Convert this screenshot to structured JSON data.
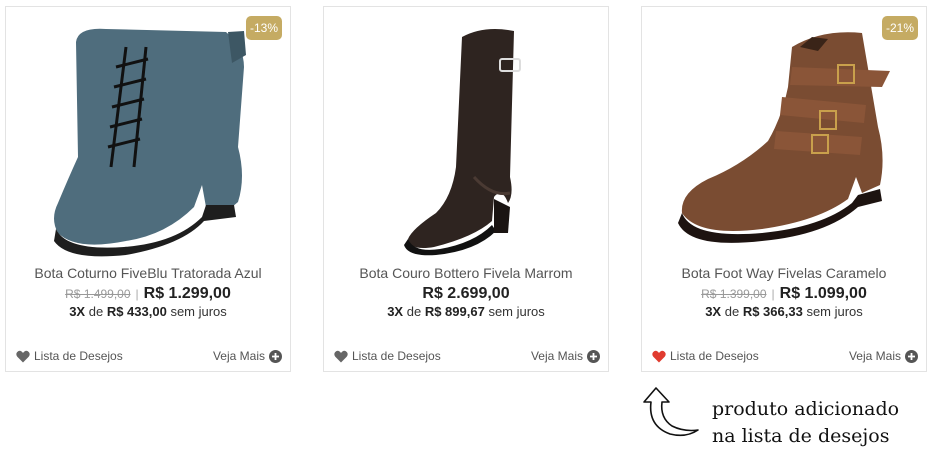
{
  "products": [
    {
      "badge": "-13%",
      "name": "Bota Coturno FiveBlu Tratorada Azul",
      "old_price": "R$ 1.499,00",
      "separator": "|",
      "price": "R$ 1.299,00",
      "installments": {
        "count": "3X",
        "word": "de",
        "amount": "R$ 433,00",
        "suffix": "sem juros"
      },
      "wishlist_label": "Lista de Desejos",
      "wishlist_added": false,
      "more_label": "Veja Mais"
    },
    {
      "name": "Bota Couro Bottero Fivela Marrom",
      "price": "R$ 2.699,00",
      "installments": {
        "count": "3X",
        "word": "de",
        "amount": "R$ 899,67",
        "suffix": "sem juros"
      },
      "wishlist_label": "Lista de Desejos",
      "wishlist_added": false,
      "more_label": "Veja Mais"
    },
    {
      "badge": "-21%",
      "name": "Bota Foot Way Fivelas Caramelo",
      "old_price": "R$ 1.399,00",
      "separator": "|",
      "price": "R$ 1.099,00",
      "installments": {
        "count": "3X",
        "word": "de",
        "amount": "R$ 366,33",
        "suffix": "sem juros"
      },
      "wishlist_label": "Lista de Desejos",
      "wishlist_added": true,
      "more_label": "Veja Mais"
    }
  ],
  "colors": {
    "badge": "#c5ab63",
    "heart_default": "#666666",
    "heart_active": "#e03b2f"
  },
  "annotation": {
    "line1": "produto adicionado",
    "line2": "na lista de desejos"
  }
}
